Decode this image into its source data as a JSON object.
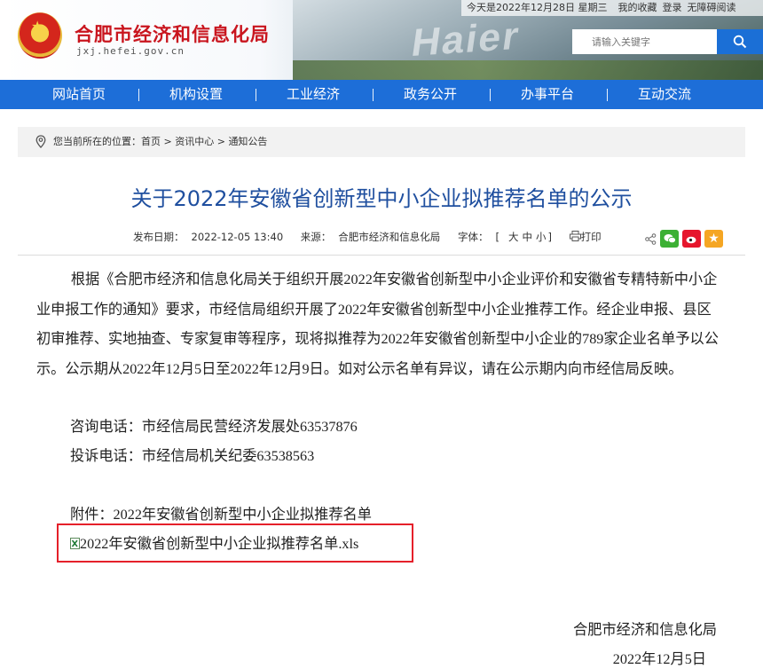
{
  "header": {
    "site_name": "合肥市经济和信息化局",
    "site_url": "jxj.hefei.gov.cn",
    "banner_text": "Haier",
    "topbar": {
      "date": "今天是2022年12月28日 星期三",
      "favorites": "我的收藏",
      "login": "登录",
      "accessibility": "无障碍阅读"
    },
    "search": {
      "placeholder": "请输入关键字"
    }
  },
  "nav": {
    "items": [
      {
        "label": "网站首页"
      },
      {
        "label": "机构设置"
      },
      {
        "label": "工业经济"
      },
      {
        "label": "政务公开"
      },
      {
        "label": "办事平台"
      },
      {
        "label": "互动交流"
      }
    ]
  },
  "breadcrumb": {
    "prefix": "您当前所在的位置：",
    "items": [
      "首页",
      "资讯中心",
      "通知公告"
    ],
    "separator": ">"
  },
  "article": {
    "title": "关于2022年安徽省创新型中小企业拟推荐名单的公示",
    "meta": {
      "publish_label": "发布日期：",
      "publish_date": "2022-12-05 13:40",
      "source_label": "来源：",
      "source": "合肥市经济和信息化局",
      "font_label": "字体：",
      "font_open": "[",
      "font_large": "大",
      "font_medium": "中",
      "font_small": "小",
      "font_close": "]",
      "print": "打印"
    },
    "paragraph": "根据《合肥市经济和信息化局关于组织开展2022年安徽省创新型中小企业评价和安徽省专精特新中小企业申报工作的通知》要求，市经信局组织开展了2022年安徽省创新型中小企业推荐工作。经企业申报、县区初审推荐、实地抽查、专家复审等程序，现将拟推荐为2022年安徽省创新型中小企业的789家企业名单予以公示。公示期从2022年12月5日至2022年12月9日。如对公示名单有异议，请在公示期内向市经信局反映。",
    "consult": "咨询电话：市经信局民营经济发展处63537876",
    "complaint": "投诉电话：市经信局机关纪委63538563",
    "attachment_label": "附件：2022年安徽省创新型中小企业拟推荐名单",
    "attachment_file": "2022年安徽省创新型中小企业拟推荐名单.xls",
    "signature_org": "合肥市经济和信息化局",
    "signature_date": "2022年12月5日"
  },
  "colors": {
    "nav_bg": "#1d6ed8",
    "title": "#1f4f9f",
    "site_name": "#c9151e",
    "highlight_box": "#e5202a",
    "wechat": "#3cb034",
    "weibo": "#e6162d",
    "qzone": "#f5a623"
  },
  "icons": [
    "location-pin-icon",
    "search-icon",
    "print-icon",
    "share-icon",
    "wechat-icon",
    "weibo-icon",
    "qzone-icon",
    "excel-file-icon"
  ]
}
